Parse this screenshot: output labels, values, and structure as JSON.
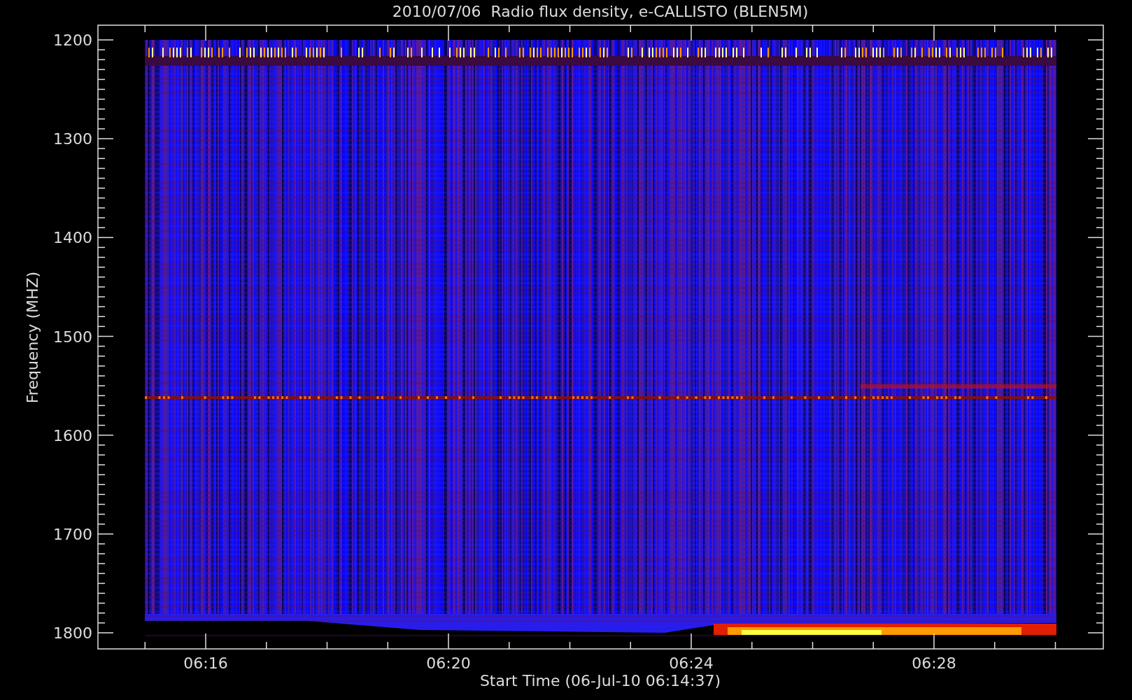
{
  "title": "2010/07/06  Radio flux density, e-CALLISTO (BLEN5M)",
  "y_axis": {
    "label": "Frequency (MHZ)",
    "ticks": [
      "1200",
      "1300",
      "1400",
      "1500",
      "1600",
      "1700",
      "1800"
    ]
  },
  "x_axis": {
    "label": "Start Time (06-Jul-10 06:14:37)",
    "ticks": [
      "06:16",
      "06:20",
      "06:24",
      "06:28"
    ]
  }
}
